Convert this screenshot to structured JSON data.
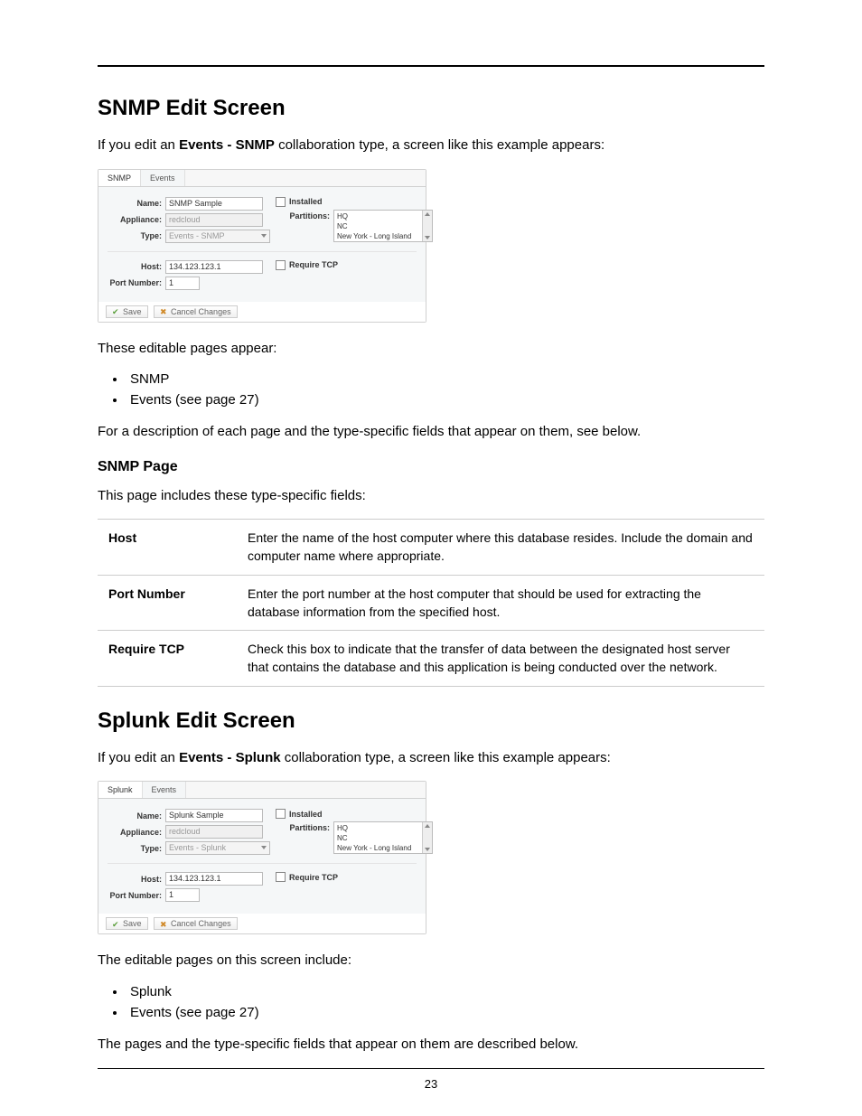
{
  "section1": {
    "heading": "SNMP Edit Screen",
    "intro_prefix": "If you edit an ",
    "intro_bold": "Events - SNMP",
    "intro_suffix": " collaboration type, a screen like this example appears:",
    "pages_intro": "These editable pages appear:",
    "pages": [
      "SNMP",
      "Events (see page 27)"
    ],
    "desc_para": "For a description of each page and the type-specific fields that appear on them, see below.",
    "subhead": "SNMP Page",
    "subhead_intro": "This page includes these type-specific fields:",
    "table": [
      {
        "k": "Host",
        "v": "Enter the name of the host computer where this database resides. Include the domain and computer name where appropriate."
      },
      {
        "k": "Port Number",
        "v": "Enter the port number at the host computer that should be used for extracting the database information from the specified host."
      },
      {
        "k": "Require TCP",
        "v": "Check this box to indicate that the transfer of data between the designated host server that contains the database and this application is being conducted over the network."
      }
    ]
  },
  "section2": {
    "heading": "Splunk Edit Screen",
    "intro_prefix": "If you edit an ",
    "intro_bold": "Events - Splunk",
    "intro_suffix": " collaboration type, a screen like this example appears:",
    "pages_intro": "The editable pages on this screen include:",
    "pages": [
      "Splunk",
      "Events (see page 27)"
    ],
    "desc_para": "The pages and the type-specific fields that appear on them are described below."
  },
  "mock1": {
    "tabs": [
      "SNMP",
      "Events"
    ],
    "labels": {
      "name": "Name:",
      "appliance": "Appliance:",
      "type": "Type:",
      "host": "Host:",
      "port": "Port Number:",
      "partitions": "Partitions:"
    },
    "name": "SNMP Sample",
    "appliance": "redcloud",
    "type": "Events - SNMP",
    "installed": "Installed",
    "partitions": [
      "HQ",
      "NC",
      "New York - Long Island Warehouse"
    ],
    "host": "134.123.123.1",
    "port": "1",
    "require_tcp": "Require TCP",
    "save": "Save",
    "cancel": "Cancel Changes"
  },
  "mock2": {
    "tabs": [
      "Splunk",
      "Events"
    ],
    "labels": {
      "name": "Name:",
      "appliance": "Appliance:",
      "type": "Type:",
      "host": "Host:",
      "port": "Port Number:",
      "partitions": "Partitions:"
    },
    "name": "Splunk Sample",
    "appliance": "redcloud",
    "type": "Events - Splunk",
    "installed": "Installed",
    "partitions": [
      "HQ",
      "NC",
      "New York - Long Island Warehouse"
    ],
    "host": "134.123.123.1",
    "port": "1",
    "require_tcp": "Require TCP",
    "save": "Save",
    "cancel": "Cancel Changes"
  },
  "page_number": "23"
}
